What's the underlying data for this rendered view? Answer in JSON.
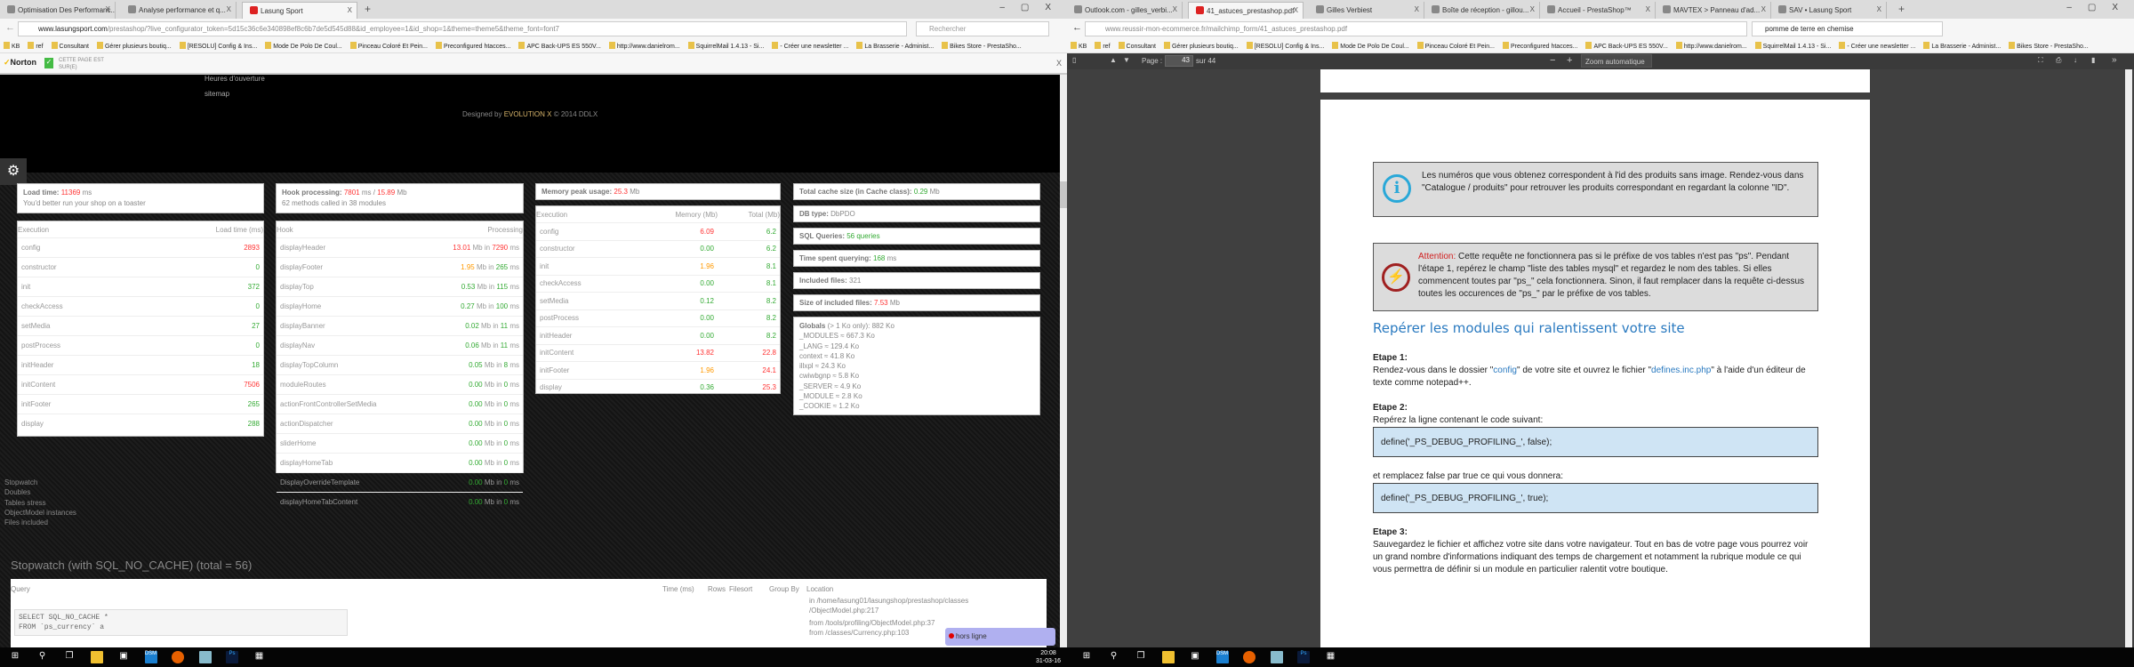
{
  "bookmarks": [
    "KB",
    "ref",
    "Consultant",
    "Gérer plusieurs boutiq...",
    "[RESOLU] Config & Ins...",
    "Mode De Polo De Coul...",
    "Pinceau Coloré Et Pein...",
    "Preconfigured htacces...",
    "APC Back-UPS ES 550V...",
    "http://www.danielrom...",
    "SquirrelMail 1.4.13 - Si...",
    "- Créer une newsletter ...",
    "La Brasserie - Administ...",
    "Bikes Store - PrestaSho..."
  ],
  "left": {
    "tabs": [
      {
        "label": "Optimisation Des Performanc..."
      },
      {
        "label": "Analyse performance et q..."
      },
      {
        "label": "Lasung Sport",
        "active": true
      }
    ],
    "url_host": "www.lasungsport.com",
    "url_path": "/prestashop/?live_configurator_token=5d15c36c6e340898ef8c6b7de5d545d88&id_employee=1&id_shop=1&theme=theme5&theme_font=font7",
    "search_placeholder": "Rechercher",
    "norton": {
      "brand": "Norton",
      "status_line1": "CETTE PAGE EST",
      "status_line2": "SUR(E)"
    },
    "footer": {
      "link1": "Heures d'ouverture",
      "link2": "sitemap",
      "credit_prefix": "Designed by ",
      "credit_brand": "EVOLUTION X",
      "credit_suffix": " © 2014 DDLX"
    },
    "load": {
      "label": "Load time:",
      "value": "11369",
      "unit": "ms",
      "note": "You'd better run your shop on a toaster"
    },
    "exec": {
      "col1": "Execution",
      "col2": "Load time (ms)",
      "rows": [
        {
          "name": "config",
          "v": "2893",
          "l": "high"
        },
        {
          "name": "constructor",
          "v": "0",
          "l": "low"
        },
        {
          "name": "init",
          "v": "372",
          "l": "low"
        },
        {
          "name": "checkAccess",
          "v": "0",
          "l": "low"
        },
        {
          "name": "setMedia",
          "v": "27",
          "l": "low"
        },
        {
          "name": "postProcess",
          "v": "0",
          "l": "low"
        },
        {
          "name": "initHeader",
          "v": "18",
          "l": "low"
        },
        {
          "name": "initContent",
          "v": "7506",
          "l": "high"
        },
        {
          "name": "initFooter",
          "v": "265",
          "l": "low"
        },
        {
          "name": "display",
          "v": "288",
          "l": "low"
        }
      ]
    },
    "hook": {
      "label": "Hook processing:",
      "ms": "7801",
      "ms_unit": "ms /",
      "mb": "15.89",
      "mb_unit": "Mb",
      "note": "62 methods called in 38 modules",
      "col1": "Hook",
      "col2": "Processing",
      "rows": [
        {
          "name": "displayHeader",
          "mb": "13.01",
          "ml": "high",
          "ms": "7290",
          "tl": "high"
        },
        {
          "name": "displayFooter",
          "mb": "1.95",
          "ml": "mid",
          "ms": "265",
          "tl": "low"
        },
        {
          "name": "displayTop",
          "mb": "0.53",
          "ml": "low",
          "ms": "115",
          "tl": "low"
        },
        {
          "name": "displayHome",
          "mb": "0.27",
          "ml": "low",
          "ms": "100",
          "tl": "low"
        },
        {
          "name": "displayBanner",
          "mb": "0.02",
          "ml": "low",
          "ms": "11",
          "tl": "low"
        },
        {
          "name": "displayNav",
          "mb": "0.06",
          "ml": "low",
          "ms": "11",
          "tl": "low"
        },
        {
          "name": "displayTopColumn",
          "mb": "0.05",
          "ml": "low",
          "ms": "8",
          "tl": "low"
        },
        {
          "name": "moduleRoutes",
          "mb": "0.00",
          "ml": "low",
          "ms": "0",
          "tl": "low"
        },
        {
          "name": "actionFrontControllerSetMedia",
          "mb": "0.00",
          "ml": "low",
          "ms": "0",
          "tl": "low"
        },
        {
          "name": "actionDispatcher",
          "mb": "0.00",
          "ml": "low",
          "ms": "0",
          "tl": "low"
        },
        {
          "name": "sliderHome",
          "mb": "0.00",
          "ml": "low",
          "ms": "0",
          "tl": "low"
        },
        {
          "name": "displayHomeTab",
          "mb": "0.00",
          "ml": "low",
          "ms": "0",
          "tl": "low"
        },
        {
          "name": "DisplayOverrideTemplate",
          "mb": "0.00",
          "ml": "low",
          "ms": "0",
          "tl": "low"
        },
        {
          "name": "displayHomeTabContent",
          "mb": "0.00",
          "ml": "low",
          "ms": "0",
          "tl": "low"
        }
      ]
    },
    "memory": {
      "label": "Memory peak usage:",
      "value": "25.3",
      "unit": "Mb",
      "col1": "Execution",
      "col2": "Memory (Mb)",
      "col3": "Total (Mb)",
      "rows": [
        {
          "name": "config",
          "m": "6.09",
          "ml": "high",
          "t": "6.2",
          "tl": "low"
        },
        {
          "name": "constructor",
          "m": "0.00",
          "ml": "low",
          "t": "6.2",
          "tl": "low"
        },
        {
          "name": "init",
          "m": "1.96",
          "ml": "mid",
          "t": "8.1",
          "tl": "low"
        },
        {
          "name": "checkAccess",
          "m": "0.00",
          "ml": "low",
          "t": "8.1",
          "tl": "low"
        },
        {
          "name": "setMedia",
          "m": "0.12",
          "ml": "low",
          "t": "8.2",
          "tl": "low"
        },
        {
          "name": "postProcess",
          "m": "0.00",
          "ml": "low",
          "t": "8.2",
          "tl": "low"
        },
        {
          "name": "initHeader",
          "m": "0.00",
          "ml": "low",
          "t": "8.2",
          "tl": "low"
        },
        {
          "name": "initContent",
          "m": "13.82",
          "ml": "high",
          "t": "22.8",
          "tl": "high"
        },
        {
          "name": "initFooter",
          "m": "1.96",
          "ml": "mid",
          "t": "24.1",
          "tl": "high"
        },
        {
          "name": "display",
          "m": "0.36",
          "ml": "low",
          "t": "25.3",
          "tl": "high"
        }
      ]
    },
    "stats": [
      {
        "label": "Total cache size (in Cache class):",
        "value": "0.29",
        "l": "low",
        "unit": "Mb"
      },
      {
        "label": "DB type:",
        "value": "DbPDO",
        "l": "",
        "unit": ""
      },
      {
        "label": "SQL Queries:",
        "value": "56 queries",
        "l": "low",
        "unit": ""
      },
      {
        "label": "Time spent querying:",
        "value": "168",
        "l": "low",
        "unit": "ms"
      },
      {
        "label": "Included files:",
        "value": "321",
        "l": "",
        "unit": ""
      },
      {
        "label": "Size of included files:",
        "value": "7.53",
        "l": "high",
        "unit": "Mb"
      }
    ],
    "globals": {
      "label": "Globals",
      "note": "(> 1 Ko only): 882 Ko",
      "items": [
        "_MODULES ≈ 667.3 Ko",
        "_LANG ≈ 129.4 Ko",
        "context ≈ 41.8 Ko",
        "illxpl ≈ 24.3 Ko",
        "cwiwbgnp ≈ 5.8 Ko",
        "_SERVER ≈ 4.9 Ko",
        "_MODULE ≈ 2.8 Ko",
        "_COOKIE ≈ 1.2 Ko"
      ]
    },
    "sections": [
      "Stopwatch",
      "Doubles",
      "Tables stress",
      "ObjectModel instances",
      "Files included"
    ],
    "stopwatch": {
      "title": "Stopwatch (with SQL_NO_CACHE) (total = 56)",
      "cols": [
        "Query",
        "Time (ms)",
        "Rows",
        "Filesort",
        "Group By",
        "Location"
      ],
      "loc1": "in /home/lasung01/lasungshop/prestashop/classes",
      "loc2": "/ObjectModel.php:217",
      "loc3": "from /tools/profiling/ObjectModel.php:37",
      "loc4": "from /classes/Currency.php:103",
      "sql1": "SELECT SQL_NO_CACHE *",
      "sql2": "FROM `ps_currency` a"
    },
    "chat": {
      "label": "hors ligne",
      "status_color": "#e00000"
    },
    "clock": {
      "time": "20:08",
      "date": "31-03-16"
    }
  },
  "right": {
    "tabs": [
      {
        "label": "Outlook.com - gilles_verbi..."
      },
      {
        "label": "41_astuces_prestashop.pdf",
        "active": true
      },
      {
        "label": "Gilles Verbiest"
      },
      {
        "label": "Boîte de réception - gillou..."
      },
      {
        "label": "Accueil - PrestaShop™"
      },
      {
        "label": "MAVTEX > Panneau d'ad..."
      },
      {
        "label": "SAV • Lasung Sport"
      }
    ],
    "url_host": "www.reussir-mon-ecommerce.fr",
    "url_path": "/mailchimp_form/41_astuces_prestashop.pdf",
    "search_value": "pomme de terre en chemise",
    "pdf_toolbar": {
      "page_label": "Page :",
      "page_value": "43",
      "page_total": "sur 44",
      "zoom": "Zoom automatique"
    },
    "pdf": {
      "info": "Les numéros que vous obtenez correspondent à l'id des produits sans image. Rendez-vous dans \"Catalogue / produits\" pour retrouver les produits correspondant en regardant la colonne \"ID\".",
      "attention_label": "Attention:",
      "attention": " Cette requête ne fonctionnera pas si le préfixe de vos tables n'est pas \"ps\". Pendant l'étape 1, repérez le champ \"liste des tables mysql\" et regardez le nom des tables. Si elles commencent toutes par \"ps_\" cela fonctionnera. Sinon, il faut remplacer dans la requête ci-dessus toutes les occurences de \"ps_\"     par le préfixe de vos tables.",
      "heading": "Repérer les modules qui ralentissent votre site",
      "step1_title": "Etape 1:",
      "step1_a": "Rendez-vous dans le dossier \"",
      "step1_link1": "config",
      "step1_b": "\" de votre site et ouvrez le fichier \"",
      "step1_link2": "defines.inc.php",
      "step1_c": "\" à l'aide d'un éditeur de texte comme notepad++.",
      "step2_title": "Etape 2:",
      "step2_text": "Repérez la ligne contenant le code suivant:",
      "code1": "define('_PS_DEBUG_PROFILING_', false);",
      "step2_b": "et remplacez false par true ce qui vous donnera:",
      "code2": "define('_PS_DEBUG_PROFILING_', true);",
      "step3_title": "Etape 3:",
      "step3_text": "Sauvegardez le fichier et affichez votre site dans votre navigateur. Tout en bas de votre page vous pourrez voir un grand nombre d'informations indiquant des temps de chargement et notamment la rubrique module ce qui vous permettra de définir si un module en particulier ralentit votre boutique."
    }
  },
  "taskbar_icons": [
    "windows-start-icon",
    "search-icon",
    "task-view-icon",
    "file-explorer-icon",
    "store-icon",
    "dsm-icon",
    "firefox-icon",
    "notepad-icon",
    "photoshop-icon",
    "calculator-icon"
  ],
  "colors": {
    "high": "#ff3333",
    "low": "#33aa33",
    "mid": "#ff9900",
    "pdf_heading": "#2a7ac0",
    "attention": "#d02020"
  }
}
